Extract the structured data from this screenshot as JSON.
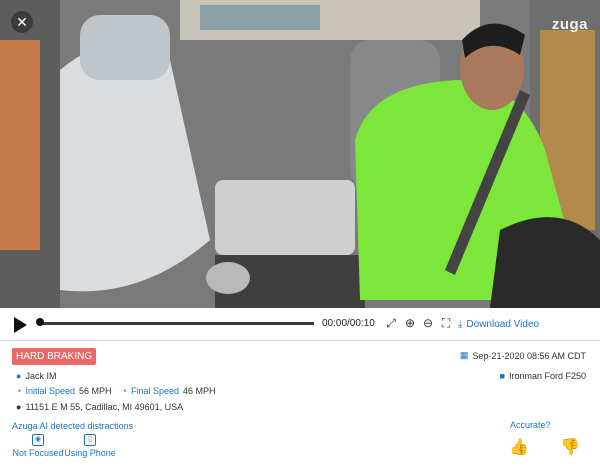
{
  "player": {
    "close_symbol": "✕",
    "logo": "zuga",
    "time": "00:00/00:10",
    "download_label": "Download Video"
  },
  "event": {
    "type_label": "HARD BRAKING",
    "datetime": "Sep-21-2020 08:56 AM CDT",
    "driver": "Jack IM",
    "vehicle": "Ironman Ford F250",
    "initial_speed_label": "Initial Speed",
    "initial_speed_value": "56 MPH",
    "final_speed_label": "Final Speed",
    "final_speed_value": "46 MPH",
    "address": "11151 E M 55, Cadillac, MI 49601, USA"
  },
  "distractions": {
    "title": "Azuga AI detected distractions",
    "items": [
      {
        "label": "Not Focused",
        "icon": "eye-icon"
      },
      {
        "label": "Using Phone",
        "icon": "phone-icon"
      }
    ]
  },
  "feedback": {
    "accurate_label": "Accurate?"
  },
  "colors": {
    "accent": "#1a73c7",
    "badge": "#e8696a"
  }
}
